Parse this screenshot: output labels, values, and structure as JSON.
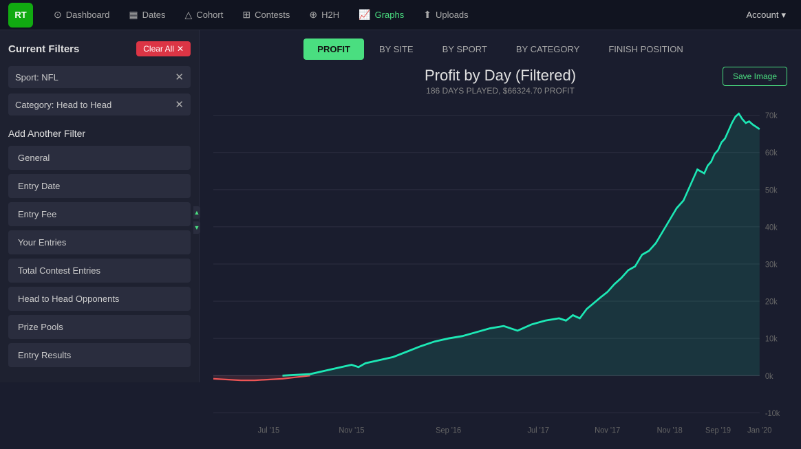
{
  "app": {
    "logo": "RT"
  },
  "navbar": {
    "items": [
      {
        "id": "dashboard",
        "label": "Dashboard",
        "icon": "⊙",
        "active": false
      },
      {
        "id": "dates",
        "label": "Dates",
        "icon": "📅",
        "active": false
      },
      {
        "id": "cohort",
        "label": "Cohort",
        "icon": "△",
        "active": false
      },
      {
        "id": "contests",
        "label": "Contests",
        "icon": "⊞",
        "active": false
      },
      {
        "id": "h2h",
        "label": "H2H",
        "icon": "⊕",
        "active": false
      },
      {
        "id": "graphs",
        "label": "Graphs",
        "icon": "📈",
        "active": true
      },
      {
        "id": "uploads",
        "label": "Uploads",
        "icon": "⬆",
        "active": false
      }
    ],
    "account_label": "Account"
  },
  "sidebar": {
    "title": "Current Filters",
    "clear_all_label": "Clear All",
    "active_filters": [
      {
        "id": "sport-filter",
        "label": "Sport: NFL"
      },
      {
        "id": "category-filter",
        "label": "Category: Head to Head"
      }
    ],
    "add_filter_title": "Add Another Filter",
    "filter_buttons": [
      {
        "id": "general",
        "label": "General"
      },
      {
        "id": "entry-date",
        "label": "Entry Date"
      },
      {
        "id": "entry-fee",
        "label": "Entry Fee"
      },
      {
        "id": "your-entries",
        "label": "Your Entries"
      },
      {
        "id": "total-contest-entries",
        "label": "Total Contest Entries"
      },
      {
        "id": "head-to-head-opponents",
        "label": "Head to Head Opponents"
      },
      {
        "id": "prize-pools",
        "label": "Prize Pools"
      },
      {
        "id": "entry-results",
        "label": "Entry Results"
      }
    ]
  },
  "chart_tabs": [
    {
      "id": "profit",
      "label": "PROFIT",
      "active": true
    },
    {
      "id": "by-site",
      "label": "BY SITE",
      "active": false
    },
    {
      "id": "by-sport",
      "label": "BY SPORT",
      "active": false
    },
    {
      "id": "by-category",
      "label": "BY CATEGORY",
      "active": false
    },
    {
      "id": "finish-position",
      "label": "FINISH POSITION",
      "active": false
    }
  ],
  "chart": {
    "title": "Profit by Day (Filtered)",
    "subtitle": "186 DAYS PLAYED, $66324.70 PROFIT",
    "save_image_label": "Save Image",
    "y_labels": [
      "70k",
      "60k",
      "50k",
      "40k",
      "30k",
      "20k",
      "10k",
      "0k",
      "-10k"
    ],
    "x_labels": [
      "Jul '15",
      "Nov '15",
      "Sep '16",
      "Jul '17",
      "Nov '17",
      "Nov '18",
      "Sep '19",
      "Jan '20"
    ]
  }
}
